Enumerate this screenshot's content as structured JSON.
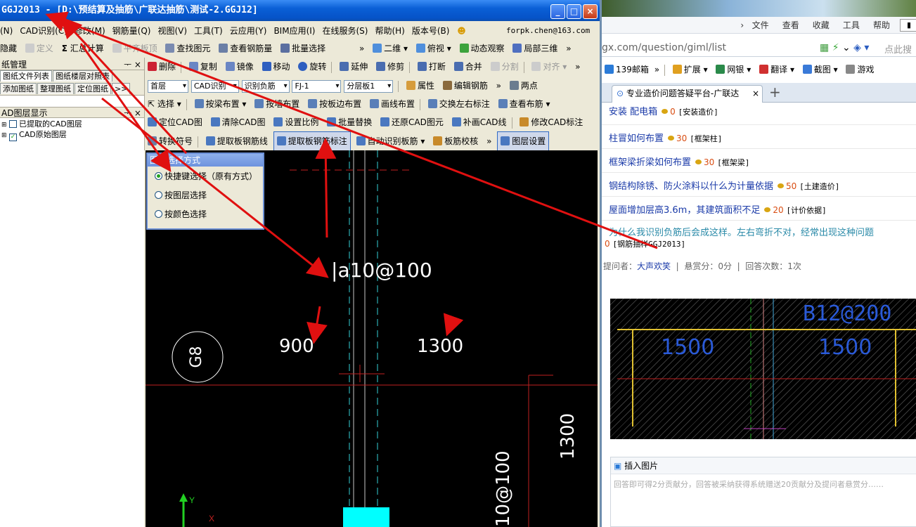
{
  "app": {
    "title": "GGJ2013 - [D:\\预结算及抽筋\\广联达抽筋\\测试-2.GGJ12]",
    "menu": [
      "(N)",
      "CAD识别(C)",
      "修改(M)",
      "钢筋量(Q)",
      "视图(V)",
      "工具(T)",
      "云应用(Y)",
      "BIM应用(I)",
      "在线服务(S)",
      "帮助(H)",
      "版本号(B)"
    ],
    "account": "forpk.chen@163.com",
    "toolbar1": [
      "隐藏",
      "定义",
      "汇总计算",
      "平齐板顶",
      "查找图元",
      "查看钢筋量",
      "批量选择"
    ],
    "toolbar1_right": [
      "二维",
      "俯视",
      "动态观察",
      "局部三维"
    ],
    "toolbar2": [
      "删除",
      "复制",
      "镜像",
      "移动",
      "旋转",
      "延伸",
      "修剪",
      "打断",
      "合并",
      "分割",
      "对齐"
    ],
    "selects": {
      "floor": "首层",
      "mode": "CAD识别",
      "type": "识别负筋",
      "code": "FJ-1",
      "layer": "分层板1"
    },
    "toolbar3_extra": [
      "属性",
      "编辑钢筋"
    ],
    "two_points": "两点",
    "toolbar4": [
      "选择",
      "按梁布置",
      "按墙布置",
      "按板边布置",
      "画线布置",
      "交换左右标注",
      "查看布筋"
    ],
    "toolbar5": [
      "定位CAD图",
      "清除CAD图",
      "设置比例",
      "批量替换",
      "还原CAD图元",
      "补画CAD线",
      "修改CAD标注"
    ],
    "toolbar6": [
      "转换符号",
      "提取板钢筋线",
      "提取板钢筋标注",
      "自动识别板筋",
      "板筋校核"
    ],
    "layer_settings": "图层设置",
    "panel1_title": "纸管理",
    "tabs": [
      "图纸文件列表",
      "图纸楼层对照表"
    ],
    "tabs2": [
      "添加图纸",
      "整理图纸",
      "定位图纸"
    ],
    "panel2_title": "AD图层显示",
    "layers": [
      {
        "label": "已提取的CAD图层",
        "checked": false
      },
      {
        "label": "CAD原始图层",
        "checked": true
      }
    ],
    "popup": {
      "title": "图线选择方式",
      "options": [
        "快捷键选择（原有方式）",
        "按图层选择",
        "按颜色选择"
      ],
      "selected": 0
    },
    "cad_texts": {
      "rebar": "a10@100",
      "dim1": "900",
      "dim2": "1300",
      "grid": "G8",
      "dim3": "1300",
      "rebar_v": "10@100"
    }
  },
  "browser": {
    "menu": [
      "文件",
      "查看",
      "收藏",
      "工具",
      "帮助"
    ],
    "url": "gx.com/question/giml/list",
    "search_placeholder": "点此搜",
    "bookmarks": [
      "139邮箱",
      "扩展",
      "网银",
      "翻译",
      "截图",
      "游戏"
    ],
    "tab_title": "专业造价问题答疑平台-广联达",
    "questions": [
      {
        "title": "安装 配电箱",
        "score": "0",
        "tag": "[安装造价]"
      },
      {
        "title": "柱冒如何布置",
        "score": "30",
        "tag": "[框架柱]"
      },
      {
        "title": "框架梁折梁如何布置",
        "score": "30",
        "tag": "[框架梁]"
      },
      {
        "title": "钢结构除锈、防火涂料以什么为计量依据",
        "score": "50",
        "tag": "[土建造价]"
      },
      {
        "title": "屋面增加层高3.6m，其建筑面积不足",
        "score": "20",
        "tag": "[计价依据]"
      },
      {
        "title": "为什么我识别负筋后会成这样。左右弯折不对，经常出现这种问题",
        "score": "0",
        "tag": "[钢筋抽样GGJ2013]"
      }
    ],
    "asker_label": "提问者：",
    "asker": "大声欢笑",
    "bounty": "悬赏分：0分",
    "answers": "回答次数：1次",
    "image_texts": {
      "rebar": "B12@200",
      "d1": "1500",
      "d2": "1500"
    },
    "insert_image": "插入图片",
    "answer_placeholder": "回答即可得2分贡献分，回答被采纳获得系统赠送20贡献分及提问者悬赏分……"
  }
}
